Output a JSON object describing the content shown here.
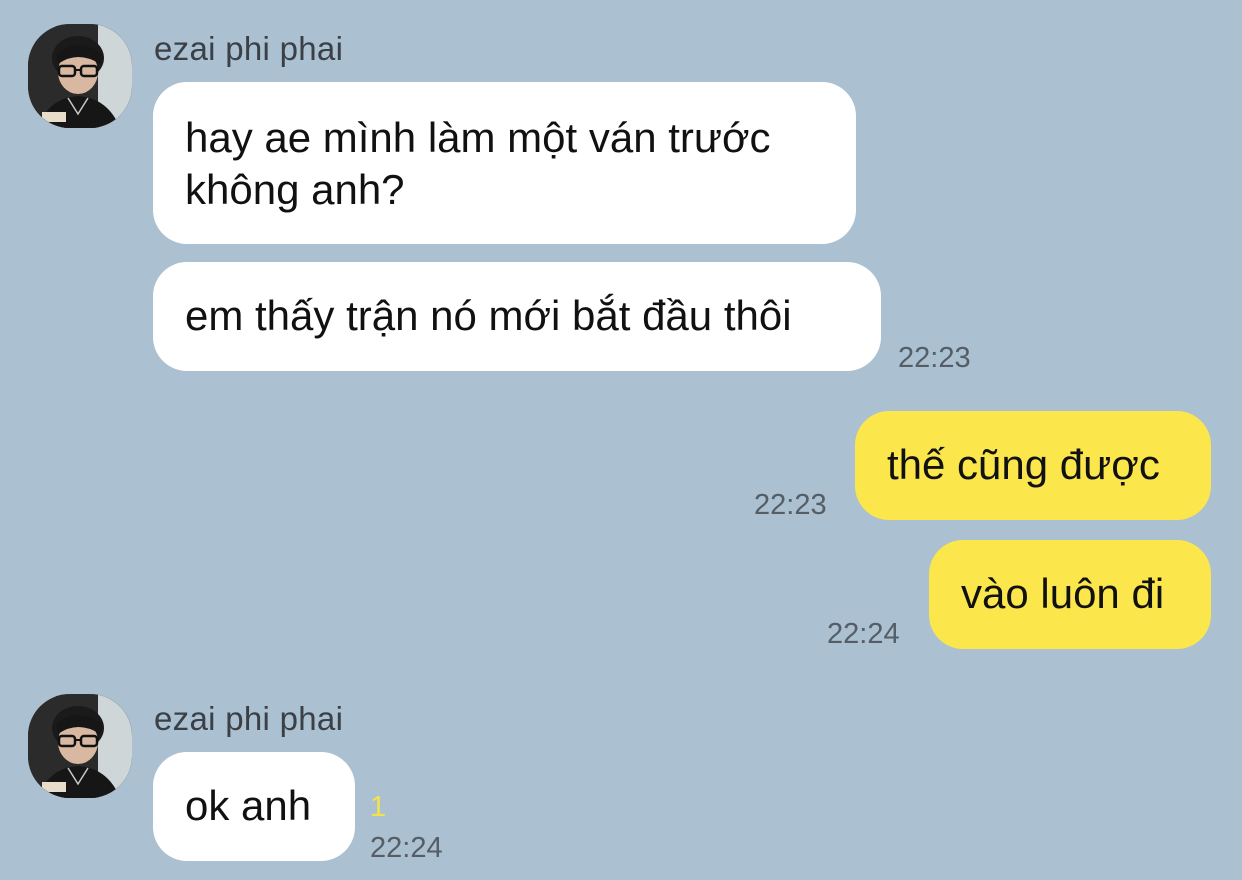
{
  "theme": {
    "background": "#abc0d0",
    "incoming_bubble": "#ffffff",
    "outgoing_bubble": "#fbe64c",
    "unread_color": "#f5e24a"
  },
  "messages": [
    {
      "direction": "incoming",
      "sender": "ezai phi phai",
      "avatar_icon": "user-avatar-photo",
      "bubbles": [
        {
          "lines": [
            "hay ae mình làm một ván trước",
            "không anh?"
          ]
        },
        {
          "lines": [
            "em thấy trận nó mới bắt đầu thôi"
          ],
          "time": "22:23"
        }
      ]
    },
    {
      "direction": "outgoing",
      "bubbles": [
        {
          "lines": [
            "thế cũng được"
          ],
          "time": "22:23"
        },
        {
          "lines": [
            "vào luôn đi"
          ],
          "time": "22:24"
        }
      ]
    },
    {
      "direction": "incoming",
      "sender": "ezai phi phai",
      "avatar_icon": "user-avatar-photo",
      "bubbles": [
        {
          "lines": [
            "ok anh"
          ],
          "time": "22:24",
          "unread": "1"
        }
      ]
    }
  ]
}
